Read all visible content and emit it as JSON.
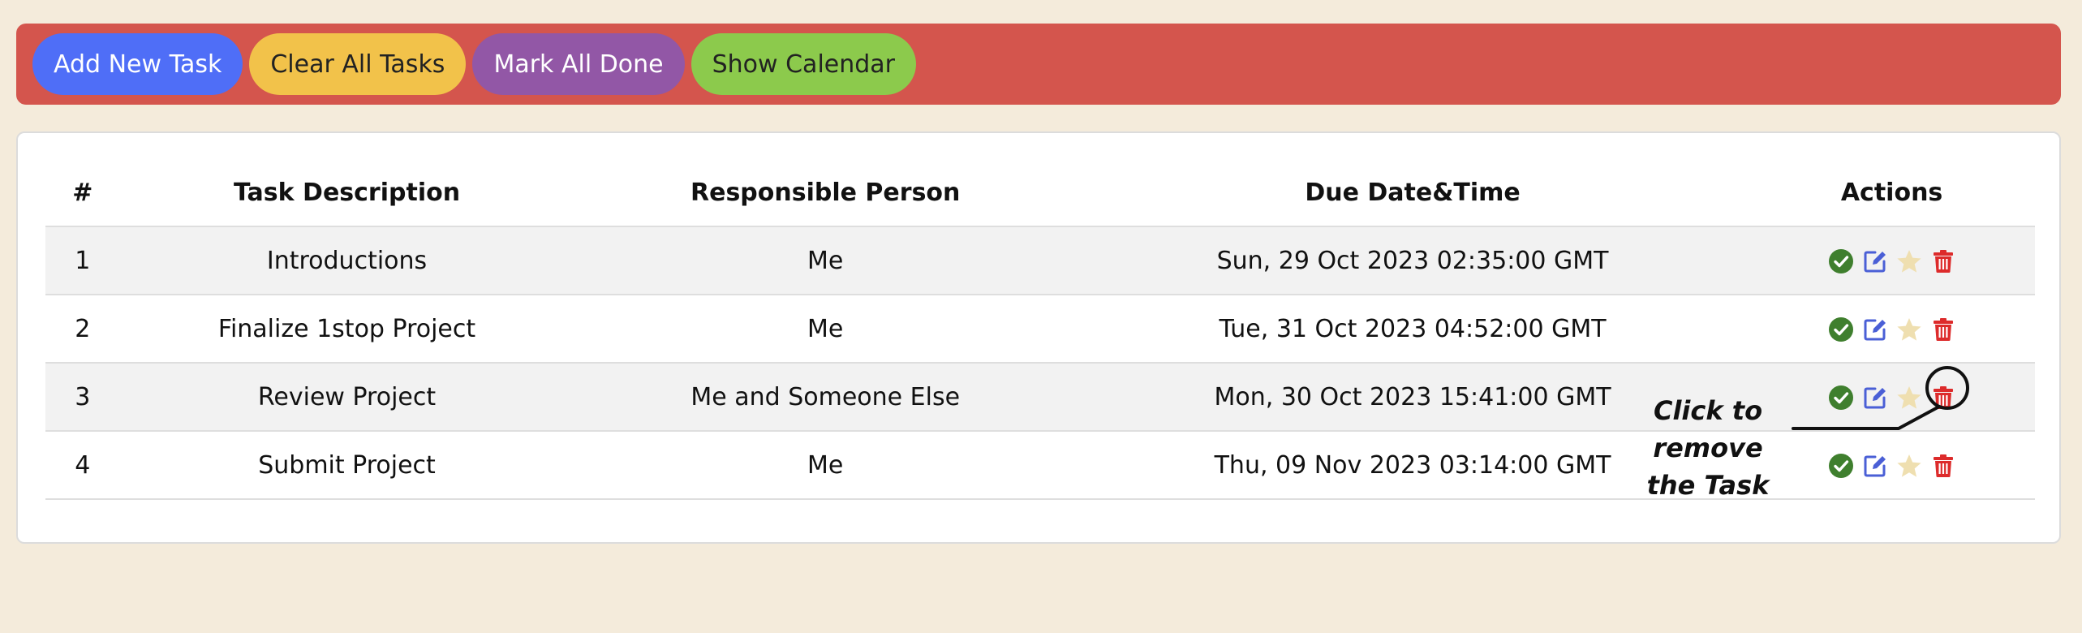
{
  "toolbar": {
    "add_label": "Add New Task",
    "clear_label": "Clear All Tasks",
    "mark_done_label": "Mark All Done",
    "calendar_label": "Show Calendar"
  },
  "table": {
    "headers": {
      "num": "#",
      "description": "Task Description",
      "person": "Responsible Person",
      "due": "Due Date&Time",
      "actions": "Actions"
    },
    "rows": [
      {
        "num": "1",
        "description": "Introductions",
        "person": "Me",
        "due": "Sun, 29 Oct 2023 02:35:00 GMT",
        "starred": false
      },
      {
        "num": "2",
        "description": "Finalize 1stop Project",
        "person": "Me",
        "due": "Tue, 31 Oct 2023 04:52:00 GMT",
        "starred": false
      },
      {
        "num": "3",
        "description": "Review Project",
        "person": "Me and Someone Else",
        "due": "Mon, 30 Oct 2023 15:41:00 GMT",
        "starred": false
      },
      {
        "num": "4",
        "description": "Submit Project",
        "person": "Me",
        "due": "Thu, 09 Nov 2023 03:14:00 GMT",
        "starred": false
      }
    ],
    "row_actions": [
      "check-icon",
      "edit-icon",
      "star-icon",
      "trash-icon"
    ]
  },
  "callout": {
    "line1": "Click to remove",
    "line2": "the Task"
  },
  "colors": {
    "background": "#f4ebdb",
    "toolbar": "#d4554d",
    "add_button": "#4f6ef7",
    "clear_button": "#f2c24a",
    "mark_done_button": "#9257a6",
    "calendar_button": "#8cca4c",
    "check_icon": "#3f7f2e",
    "edit_icon": "#4a5fd6",
    "star_icon": "#efdfb0",
    "trash_icon": "#dd2b2b"
  }
}
